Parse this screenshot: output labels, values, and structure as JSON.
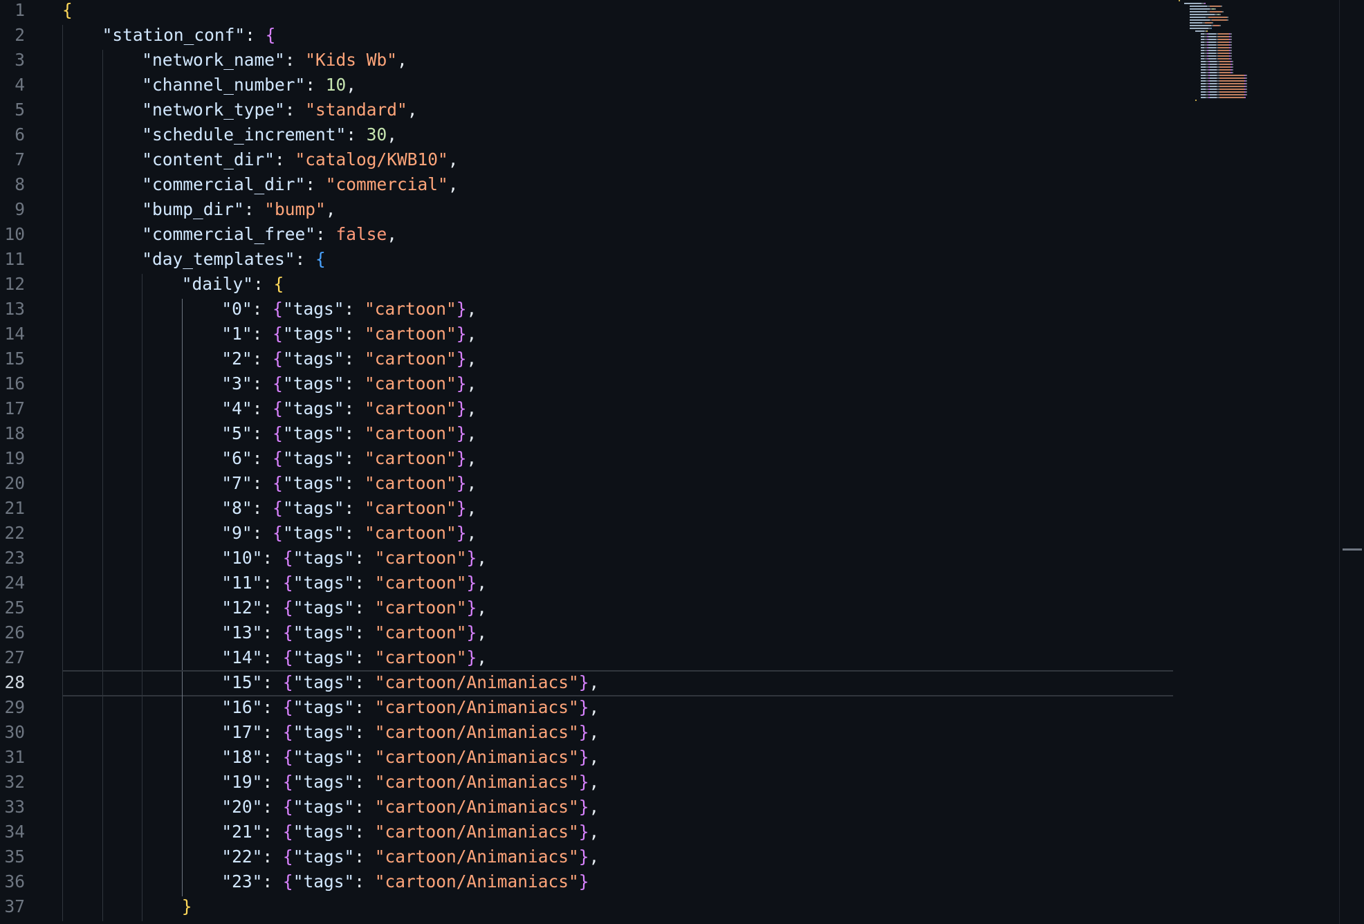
{
  "editor": {
    "active_line": 28,
    "lines": [
      {
        "n": 1,
        "indent": 0,
        "t": [
          [
            "b1",
            "{"
          ]
        ]
      },
      {
        "n": 2,
        "indent": 1,
        "t": [
          [
            "k",
            "\"station_conf\""
          ],
          [
            "p",
            ": "
          ],
          [
            "b2",
            "{"
          ]
        ]
      },
      {
        "n": 3,
        "indent": 2,
        "t": [
          [
            "k",
            "\"network_name\""
          ],
          [
            "p",
            ": "
          ],
          [
            "s",
            "\"Kids Wb\""
          ],
          [
            "p",
            ","
          ]
        ]
      },
      {
        "n": 4,
        "indent": 2,
        "t": [
          [
            "k",
            "\"channel_number\""
          ],
          [
            "p",
            ": "
          ],
          [
            "n",
            "10"
          ],
          [
            "p",
            ","
          ]
        ]
      },
      {
        "n": 5,
        "indent": 2,
        "t": [
          [
            "k",
            "\"network_type\""
          ],
          [
            "p",
            ": "
          ],
          [
            "s",
            "\"standard\""
          ],
          [
            "p",
            ","
          ]
        ]
      },
      {
        "n": 6,
        "indent": 2,
        "t": [
          [
            "k",
            "\"schedule_increment\""
          ],
          [
            "p",
            ": "
          ],
          [
            "n",
            "30"
          ],
          [
            "p",
            ","
          ]
        ]
      },
      {
        "n": 7,
        "indent": 2,
        "t": [
          [
            "k",
            "\"content_dir\""
          ],
          [
            "p",
            ": "
          ],
          [
            "s",
            "\"catalog/KWB10\""
          ],
          [
            "p",
            ","
          ]
        ]
      },
      {
        "n": 8,
        "indent": 2,
        "t": [
          [
            "k",
            "\"commercial_dir\""
          ],
          [
            "p",
            ": "
          ],
          [
            "s",
            "\"commercial\""
          ],
          [
            "p",
            ","
          ]
        ]
      },
      {
        "n": 9,
        "indent": 2,
        "t": [
          [
            "k",
            "\"bump_dir\""
          ],
          [
            "p",
            ": "
          ],
          [
            "s",
            "\"bump\""
          ],
          [
            "p",
            ","
          ]
        ]
      },
      {
        "n": 10,
        "indent": 2,
        "t": [
          [
            "k",
            "\"commercial_free\""
          ],
          [
            "p",
            ": "
          ],
          [
            "kw",
            "false"
          ],
          [
            "p",
            ","
          ]
        ]
      },
      {
        "n": 11,
        "indent": 2,
        "t": [
          [
            "k",
            "\"day_templates\""
          ],
          [
            "p",
            ": "
          ],
          [
            "b3",
            "{"
          ]
        ]
      },
      {
        "n": 12,
        "indent": 3,
        "t": [
          [
            "k",
            "\"daily\""
          ],
          [
            "p",
            ": "
          ],
          [
            "b1",
            "{"
          ]
        ]
      },
      {
        "n": 13,
        "indent": 4,
        "t": [
          [
            "k",
            "\"0\""
          ],
          [
            "p",
            ": "
          ],
          [
            "b2",
            "{"
          ],
          [
            "k",
            "\"tags\""
          ],
          [
            "p",
            ": "
          ],
          [
            "s",
            "\"cartoon\""
          ],
          [
            "b2",
            "}"
          ],
          [
            "p",
            ","
          ]
        ]
      },
      {
        "n": 14,
        "indent": 4,
        "t": [
          [
            "k",
            "\"1\""
          ],
          [
            "p",
            ": "
          ],
          [
            "b2",
            "{"
          ],
          [
            "k",
            "\"tags\""
          ],
          [
            "p",
            ": "
          ],
          [
            "s",
            "\"cartoon\""
          ],
          [
            "b2",
            "}"
          ],
          [
            "p",
            ","
          ]
        ]
      },
      {
        "n": 15,
        "indent": 4,
        "t": [
          [
            "k",
            "\"2\""
          ],
          [
            "p",
            ": "
          ],
          [
            "b2",
            "{"
          ],
          [
            "k",
            "\"tags\""
          ],
          [
            "p",
            ": "
          ],
          [
            "s",
            "\"cartoon\""
          ],
          [
            "b2",
            "}"
          ],
          [
            "p",
            ","
          ]
        ]
      },
      {
        "n": 16,
        "indent": 4,
        "t": [
          [
            "k",
            "\"3\""
          ],
          [
            "p",
            ": "
          ],
          [
            "b2",
            "{"
          ],
          [
            "k",
            "\"tags\""
          ],
          [
            "p",
            ": "
          ],
          [
            "s",
            "\"cartoon\""
          ],
          [
            "b2",
            "}"
          ],
          [
            "p",
            ","
          ]
        ]
      },
      {
        "n": 17,
        "indent": 4,
        "t": [
          [
            "k",
            "\"4\""
          ],
          [
            "p",
            ": "
          ],
          [
            "b2",
            "{"
          ],
          [
            "k",
            "\"tags\""
          ],
          [
            "p",
            ": "
          ],
          [
            "s",
            "\"cartoon\""
          ],
          [
            "b2",
            "}"
          ],
          [
            "p",
            ","
          ]
        ]
      },
      {
        "n": 18,
        "indent": 4,
        "t": [
          [
            "k",
            "\"5\""
          ],
          [
            "p",
            ": "
          ],
          [
            "b2",
            "{"
          ],
          [
            "k",
            "\"tags\""
          ],
          [
            "p",
            ": "
          ],
          [
            "s",
            "\"cartoon\""
          ],
          [
            "b2",
            "}"
          ],
          [
            "p",
            ","
          ]
        ]
      },
      {
        "n": 19,
        "indent": 4,
        "t": [
          [
            "k",
            "\"6\""
          ],
          [
            "p",
            ": "
          ],
          [
            "b2",
            "{"
          ],
          [
            "k",
            "\"tags\""
          ],
          [
            "p",
            ": "
          ],
          [
            "s",
            "\"cartoon\""
          ],
          [
            "b2",
            "}"
          ],
          [
            "p",
            ","
          ]
        ]
      },
      {
        "n": 20,
        "indent": 4,
        "t": [
          [
            "k",
            "\"7\""
          ],
          [
            "p",
            ": "
          ],
          [
            "b2",
            "{"
          ],
          [
            "k",
            "\"tags\""
          ],
          [
            "p",
            ": "
          ],
          [
            "s",
            "\"cartoon\""
          ],
          [
            "b2",
            "}"
          ],
          [
            "p",
            ","
          ]
        ]
      },
      {
        "n": 21,
        "indent": 4,
        "t": [
          [
            "k",
            "\"8\""
          ],
          [
            "p",
            ": "
          ],
          [
            "b2",
            "{"
          ],
          [
            "k",
            "\"tags\""
          ],
          [
            "p",
            ": "
          ],
          [
            "s",
            "\"cartoon\""
          ],
          [
            "b2",
            "}"
          ],
          [
            "p",
            ","
          ]
        ]
      },
      {
        "n": 22,
        "indent": 4,
        "t": [
          [
            "k",
            "\"9\""
          ],
          [
            "p",
            ": "
          ],
          [
            "b2",
            "{"
          ],
          [
            "k",
            "\"tags\""
          ],
          [
            "p",
            ": "
          ],
          [
            "s",
            "\"cartoon\""
          ],
          [
            "b2",
            "}"
          ],
          [
            "p",
            ","
          ]
        ]
      },
      {
        "n": 23,
        "indent": 4,
        "t": [
          [
            "k",
            "\"10\""
          ],
          [
            "p",
            ": "
          ],
          [
            "b2",
            "{"
          ],
          [
            "k",
            "\"tags\""
          ],
          [
            "p",
            ": "
          ],
          [
            "s",
            "\"cartoon\""
          ],
          [
            "b2",
            "}"
          ],
          [
            "p",
            ","
          ]
        ]
      },
      {
        "n": 24,
        "indent": 4,
        "t": [
          [
            "k",
            "\"11\""
          ],
          [
            "p",
            ": "
          ],
          [
            "b2",
            "{"
          ],
          [
            "k",
            "\"tags\""
          ],
          [
            "p",
            ": "
          ],
          [
            "s",
            "\"cartoon\""
          ],
          [
            "b2",
            "}"
          ],
          [
            "p",
            ","
          ]
        ]
      },
      {
        "n": 25,
        "indent": 4,
        "t": [
          [
            "k",
            "\"12\""
          ],
          [
            "p",
            ": "
          ],
          [
            "b2",
            "{"
          ],
          [
            "k",
            "\"tags\""
          ],
          [
            "p",
            ": "
          ],
          [
            "s",
            "\"cartoon\""
          ],
          [
            "b2",
            "}"
          ],
          [
            "p",
            ","
          ]
        ]
      },
      {
        "n": 26,
        "indent": 4,
        "t": [
          [
            "k",
            "\"13\""
          ],
          [
            "p",
            ": "
          ],
          [
            "b2",
            "{"
          ],
          [
            "k",
            "\"tags\""
          ],
          [
            "p",
            ": "
          ],
          [
            "s",
            "\"cartoon\""
          ],
          [
            "b2",
            "}"
          ],
          [
            "p",
            ","
          ]
        ]
      },
      {
        "n": 27,
        "indent": 4,
        "t": [
          [
            "k",
            "\"14\""
          ],
          [
            "p",
            ": "
          ],
          [
            "b2",
            "{"
          ],
          [
            "k",
            "\"tags\""
          ],
          [
            "p",
            ": "
          ],
          [
            "s",
            "\"cartoon\""
          ],
          [
            "b2",
            "}"
          ],
          [
            "p",
            ","
          ]
        ]
      },
      {
        "n": 28,
        "indent": 4,
        "t": [
          [
            "k",
            "\"15\""
          ],
          [
            "p",
            ": "
          ],
          [
            "b2",
            "{"
          ],
          [
            "k",
            "\"tags\""
          ],
          [
            "p",
            ": "
          ],
          [
            "s",
            "\"cartoon/Animaniacs\""
          ],
          [
            "b2",
            "}"
          ],
          [
            "p",
            ","
          ]
        ]
      },
      {
        "n": 29,
        "indent": 4,
        "t": [
          [
            "k",
            "\"16\""
          ],
          [
            "p",
            ": "
          ],
          [
            "b2",
            "{"
          ],
          [
            "k",
            "\"tags\""
          ],
          [
            "p",
            ": "
          ],
          [
            "s",
            "\"cartoon/Animaniacs\""
          ],
          [
            "b2",
            "}"
          ],
          [
            "p",
            ","
          ]
        ]
      },
      {
        "n": 30,
        "indent": 4,
        "t": [
          [
            "k",
            "\"17\""
          ],
          [
            "p",
            ": "
          ],
          [
            "b2",
            "{"
          ],
          [
            "k",
            "\"tags\""
          ],
          [
            "p",
            ": "
          ],
          [
            "s",
            "\"cartoon/Animaniacs\""
          ],
          [
            "b2",
            "}"
          ],
          [
            "p",
            ","
          ]
        ]
      },
      {
        "n": 31,
        "indent": 4,
        "t": [
          [
            "k",
            "\"18\""
          ],
          [
            "p",
            ": "
          ],
          [
            "b2",
            "{"
          ],
          [
            "k",
            "\"tags\""
          ],
          [
            "p",
            ": "
          ],
          [
            "s",
            "\"cartoon/Animaniacs\""
          ],
          [
            "b2",
            "}"
          ],
          [
            "p",
            ","
          ]
        ]
      },
      {
        "n": 32,
        "indent": 4,
        "t": [
          [
            "k",
            "\"19\""
          ],
          [
            "p",
            ": "
          ],
          [
            "b2",
            "{"
          ],
          [
            "k",
            "\"tags\""
          ],
          [
            "p",
            ": "
          ],
          [
            "s",
            "\"cartoon/Animaniacs\""
          ],
          [
            "b2",
            "}"
          ],
          [
            "p",
            ","
          ]
        ]
      },
      {
        "n": 33,
        "indent": 4,
        "t": [
          [
            "k",
            "\"20\""
          ],
          [
            "p",
            ": "
          ],
          [
            "b2",
            "{"
          ],
          [
            "k",
            "\"tags\""
          ],
          [
            "p",
            ": "
          ],
          [
            "s",
            "\"cartoon/Animaniacs\""
          ],
          [
            "b2",
            "}"
          ],
          [
            "p",
            ","
          ]
        ]
      },
      {
        "n": 34,
        "indent": 4,
        "t": [
          [
            "k",
            "\"21\""
          ],
          [
            "p",
            ": "
          ],
          [
            "b2",
            "{"
          ],
          [
            "k",
            "\"tags\""
          ],
          [
            "p",
            ": "
          ],
          [
            "s",
            "\"cartoon/Animaniacs\""
          ],
          [
            "b2",
            "}"
          ],
          [
            "p",
            ","
          ]
        ]
      },
      {
        "n": 35,
        "indent": 4,
        "t": [
          [
            "k",
            "\"22\""
          ],
          [
            "p",
            ": "
          ],
          [
            "b2",
            "{"
          ],
          [
            "k",
            "\"tags\""
          ],
          [
            "p",
            ": "
          ],
          [
            "s",
            "\"cartoon/Animaniacs\""
          ],
          [
            "b2",
            "}"
          ],
          [
            "p",
            ","
          ]
        ]
      },
      {
        "n": 36,
        "indent": 4,
        "t": [
          [
            "k",
            "\"23\""
          ],
          [
            "p",
            ": "
          ],
          [
            "b2",
            "{"
          ],
          [
            "k",
            "\"tags\""
          ],
          [
            "p",
            ": "
          ],
          [
            "s",
            "\"cartoon/Animaniacs\""
          ],
          [
            "b2",
            "}"
          ]
        ]
      },
      {
        "n": 37,
        "indent": 3,
        "t": [
          [
            "b1",
            "}"
          ]
        ]
      }
    ]
  },
  "colors": {
    "background": "#0d1117",
    "key": "#d2e8ff",
    "string": "#ffa57a",
    "number": "#c6e5b0",
    "keyword": "#ff9b7a",
    "bracket_level1": "#ffd95a",
    "bracket_level2": "#d982ff",
    "bracket_level3": "#4aa3ff"
  }
}
